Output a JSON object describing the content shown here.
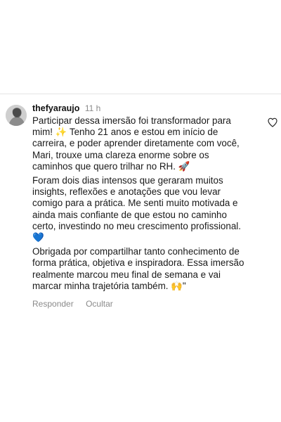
{
  "comment": {
    "username": "thefyaraujo",
    "time": "11 h",
    "lines": [
      "Participar dessa imersão foi transformador para",
      "mim! ✨ Tenho 21 anos e estou em início de",
      "carreira, e poder aprender diretamente com você,",
      "Mari, trouxe uma clareza enorme sobre os",
      "caminhos que quero trilhar no RH. 🚀",
      "Foram dois dias intensos que geraram muitos",
      "insights, reflexões e anotações que vou levar",
      "comigo para a prática. Me senti muito motivada e",
      "ainda mais confiante de que estou no caminho",
      "certo, investindo no meu crescimento profissional.",
      "💙",
      "Obrigada por compartilhar tanto conhecimento de",
      "forma prática, objetiva e inspiradora. Essa imersão",
      "realmente marcou meu final de semana e vai",
      "marcar minha trajetória também. 🙌\""
    ],
    "actions": {
      "reply": "Responder",
      "hide": "Ocultar"
    },
    "icons": {
      "like": "heart-outline-icon",
      "avatar": "user-avatar"
    }
  }
}
